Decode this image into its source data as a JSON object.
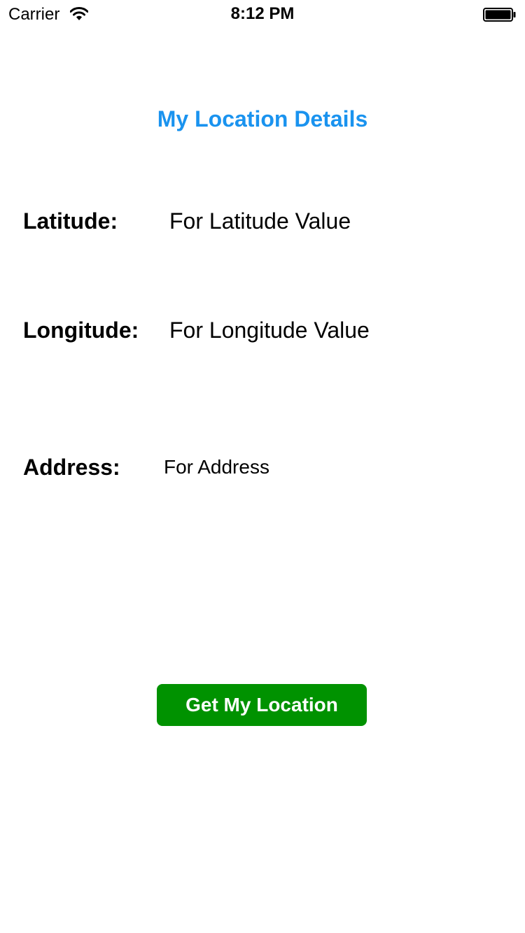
{
  "status_bar": {
    "carrier": "Carrier",
    "time": "8:12 PM",
    "wifi_icon": "wifi-icon",
    "battery_icon": "battery-full-icon",
    "battery_level": 1.0
  },
  "screen": {
    "title": "My Location Details",
    "title_color": "#1a93ef"
  },
  "fields": {
    "latitude": {
      "label": "Latitude:",
      "value": "For Latitude Value"
    },
    "longitude": {
      "label": "Longitude:",
      "value": "For Longitude Value"
    },
    "address": {
      "label": "Address:",
      "value": "For Address"
    }
  },
  "action": {
    "label": "Get My Location",
    "background": "#009200",
    "text_color": "#ffffff"
  }
}
